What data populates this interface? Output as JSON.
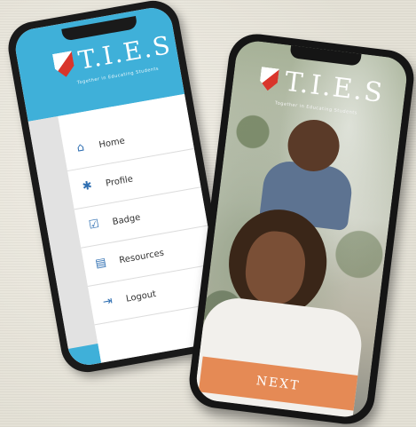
{
  "left_phone": {
    "logo": {
      "text": "T.I.E.S",
      "tagline": "Together in Educating Students"
    },
    "menu": [
      {
        "label": "Home",
        "icon": "home-icon",
        "glyph": "⌂"
      },
      {
        "label": "Profile",
        "icon": "gear-icon",
        "glyph": "✱"
      },
      {
        "label": "Badge",
        "icon": "check-badge-icon",
        "glyph": "☑"
      },
      {
        "label": "Resources",
        "icon": "clipboard-icon",
        "glyph": "▤"
      },
      {
        "label": "Logout",
        "icon": "logout-icon",
        "glyph": "⇥"
      }
    ]
  },
  "right_phone": {
    "logo": {
      "text": "T.I.E.S",
      "tagline": "Together in Educating Students"
    },
    "next_button": "NEXT"
  },
  "colors": {
    "header_blue": "#3fb0d9",
    "next_orange": "#e58a55",
    "icon_blue": "#2f6fb2"
  }
}
